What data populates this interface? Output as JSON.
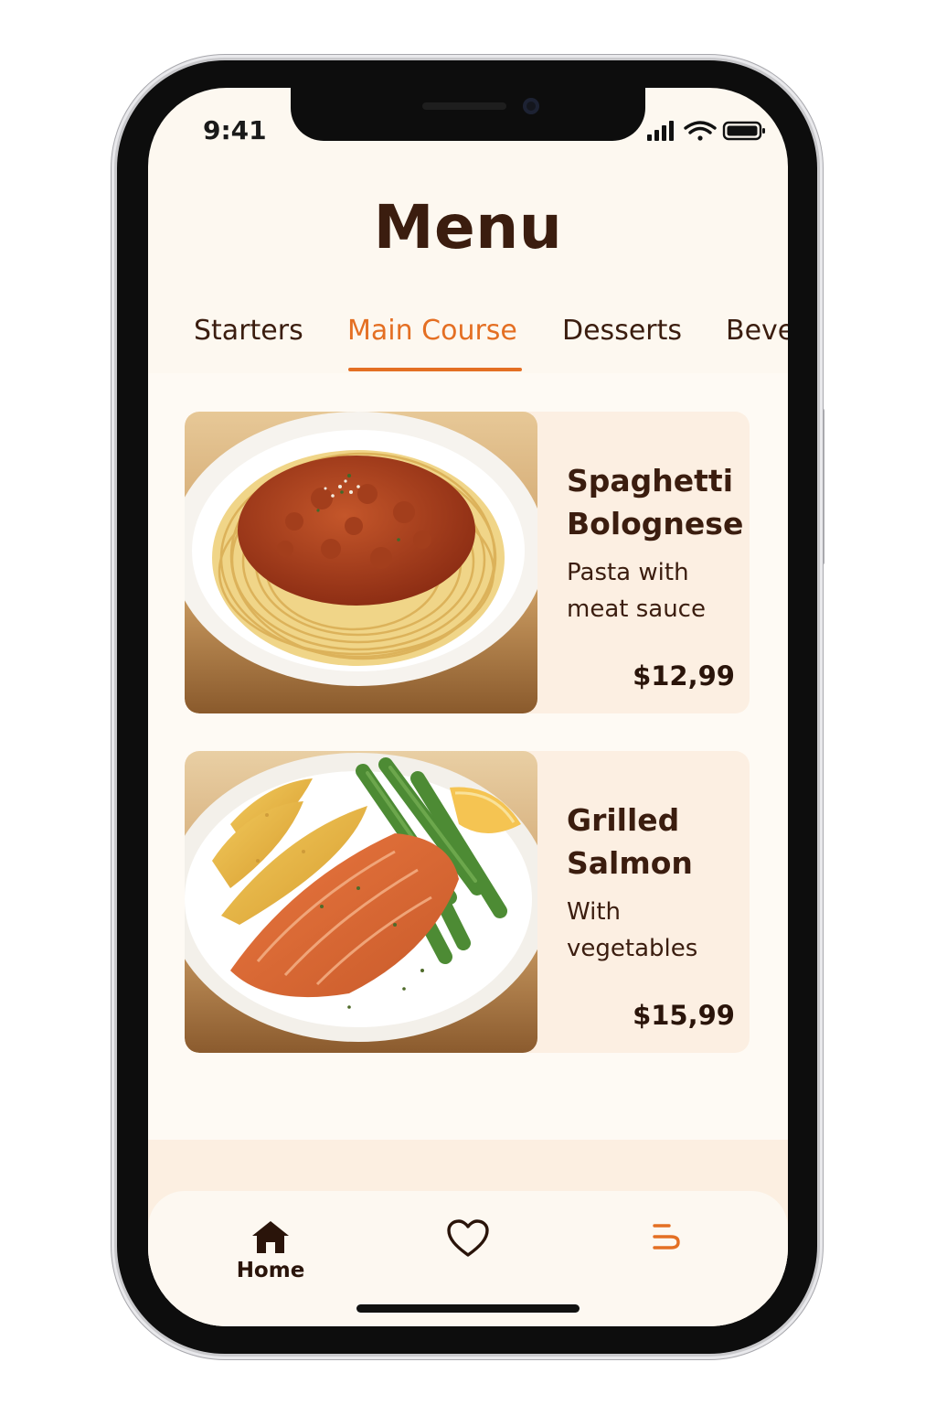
{
  "status_bar": {
    "time": "9:41"
  },
  "header": {
    "title": "Menu"
  },
  "tabs": [
    {
      "label": "Starters",
      "active": false
    },
    {
      "label": "Main Course",
      "active": true
    },
    {
      "label": "Desserts",
      "active": false
    },
    {
      "label": "Beve",
      "active": false
    }
  ],
  "menu_items": [
    {
      "name_line1": "Spaghetti",
      "name_line2": "Bolognese",
      "desc_line1": "Pasta with",
      "desc_line2": "meat sauce",
      "price": "$12,99",
      "image": "spaghetti-bolognese-photo"
    },
    {
      "name_line1": "Grilled",
      "name_line2": "Salmon",
      "desc_line1": "With",
      "desc_line2": "vegetables",
      "price": "$15,99",
      "image": "grilled-salmon-photo"
    }
  ],
  "bottom_nav": {
    "home_label": "Home",
    "home_icon": "house-icon",
    "favorites_icon": "heart-icon",
    "menu_icon": "menu-icon"
  },
  "colors": {
    "accent": "#e46f23",
    "text_dark": "#3b1d0f",
    "background": "#fdf8f0",
    "card_background": "#fcefe2"
  }
}
